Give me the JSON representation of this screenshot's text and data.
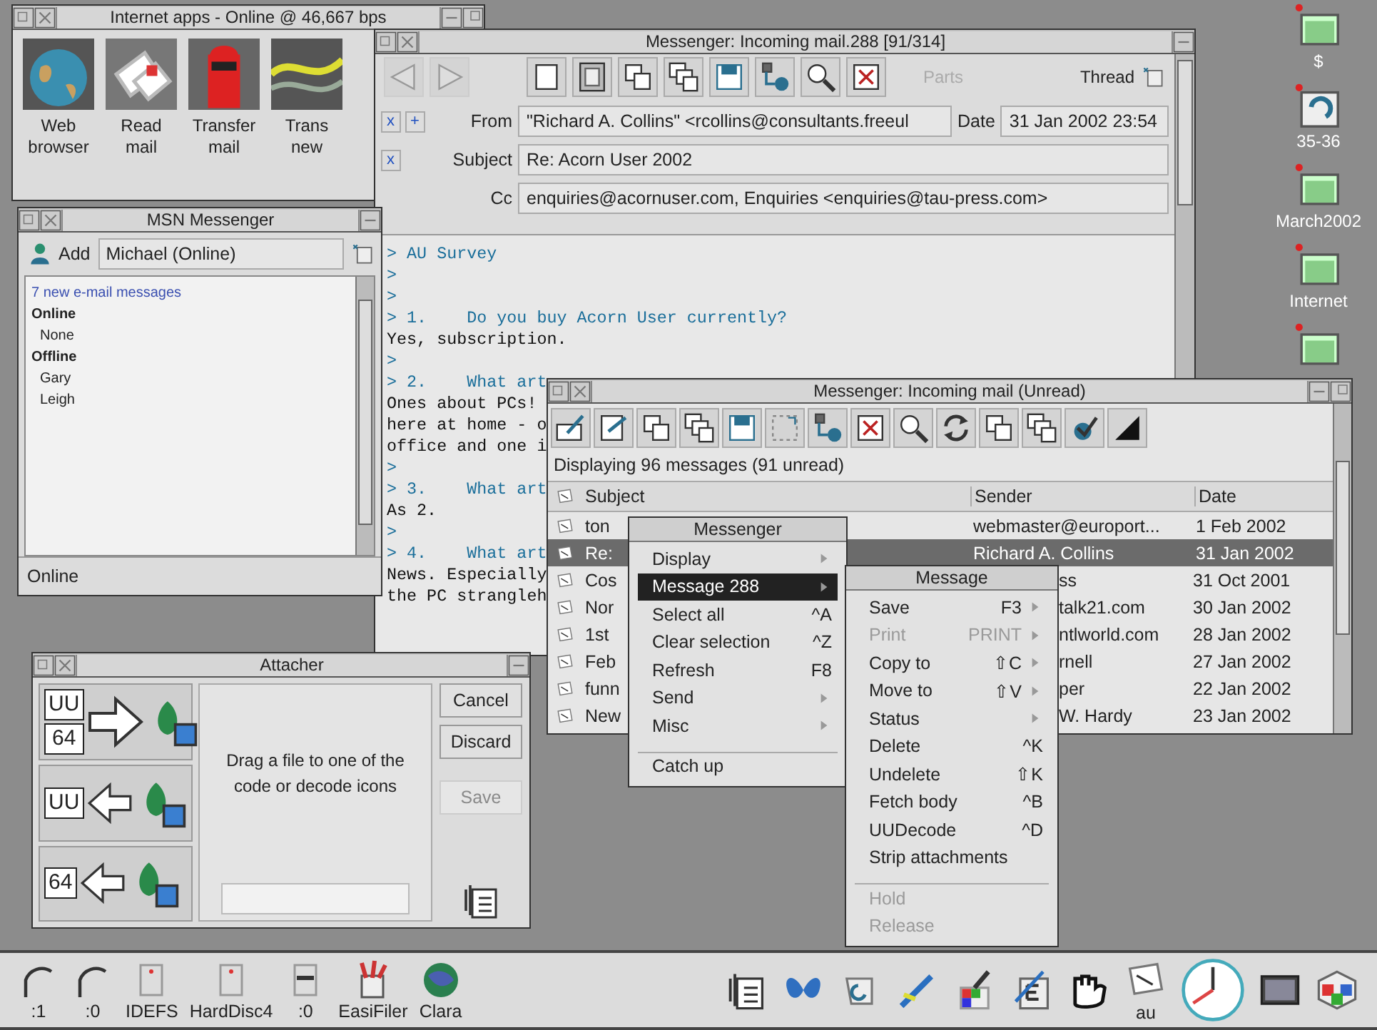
{
  "internet_apps": {
    "title": "Internet apps - Online @ 46,667 bps",
    "apps": [
      {
        "kind": "globe",
        "label_lines": [
          "Web",
          "browser"
        ]
      },
      {
        "kind": "letters",
        "label_lines": [
          "Read",
          "mail"
        ]
      },
      {
        "kind": "postbox",
        "label_lines": [
          "Transfer",
          "mail"
        ]
      },
      {
        "kind": "cable",
        "label_lines": [
          "Trans",
          "new"
        ]
      }
    ]
  },
  "mail_window": {
    "title": "Messenger: Incoming mail.288 [91/314]",
    "parts": {
      "label": "Parts",
      "disabled": true
    },
    "thread_label": "Thread",
    "from": {
      "toggles": [
        "x",
        "+"
      ],
      "label": "From",
      "value": "\"Richard A. Collins\" <rcollins@consultants.freeul",
      "date_label": "Date",
      "date": "31 Jan 2002 23:54"
    },
    "subject": {
      "toggles": [
        "x"
      ],
      "label": "Subject",
      "value": "Re: Acorn User 2002"
    },
    "cc": {
      "label": "Cc",
      "value": "enquiries@acornuser.com, Enquiries <enquiries@tau-press.com>"
    },
    "body_lines": [
      {
        "kind": "quote",
        "text": "> AU Survey"
      },
      {
        "kind": "quote",
        "text": ">"
      },
      {
        "kind": "quote",
        "text": ">"
      },
      {
        "kind": "quote",
        "text": "> 1.    Do you buy Acorn User currently?"
      },
      {
        "kind": "plain",
        "text": "Yes, subscription."
      },
      {
        "kind": "quote",
        "text": ">"
      },
      {
        "kind": "quote",
        "text": "> 2.    What art"
      },
      {
        "kind": "plain",
        "text": "Ones about PCs!"
      },
      {
        "kind": "plain",
        "text": "here at home - o"
      },
      {
        "kind": "plain",
        "text": "office and one i"
      },
      {
        "kind": "quote",
        "text": ">"
      },
      {
        "kind": "quote",
        "text": "> 3.    What art"
      },
      {
        "kind": "plain",
        "text": "As 2."
      },
      {
        "kind": "quote",
        "text": ">"
      },
      {
        "kind": "quote",
        "text": "> 4.    What art"
      },
      {
        "kind": "plain",
        "text": "News. Especially"
      },
      {
        "kind": "plain",
        "text": "the PC strangleh"
      }
    ]
  },
  "msn": {
    "title": "MSN Messenger",
    "add_label": "Add",
    "user": "Michael (Online)",
    "entries": [
      {
        "kind": "link",
        "text": "7 new e-mail messages"
      },
      {
        "kind": "heading",
        "text": "Online"
      },
      {
        "kind": "contact",
        "text": "None"
      },
      {
        "kind": "heading",
        "text": "Offline"
      },
      {
        "kind": "contact",
        "text": "Gary"
      },
      {
        "kind": "contact",
        "text": "Leigh"
      }
    ],
    "status": "Online"
  },
  "list_window": {
    "title": "Messenger: Incoming mail (Unread)",
    "status": "Displaying 96 messages (91 unread)",
    "columns": [
      "Subject",
      "Sender",
      "Date"
    ],
    "rows": [
      {
        "subject": "ton",
        "sender": "webmaster@europort...",
        "date": "1 Feb 2002",
        "selected": false,
        "sender_covered": false
      },
      {
        "subject": "Re:",
        "sender": "Richard A. Collins",
        "date": "31 Jan 2002",
        "selected": true,
        "sender_covered": false
      },
      {
        "subject": "Cos",
        "sender": "ss",
        "date": "31 Oct 2001",
        "selected": false,
        "sender_covered": true
      },
      {
        "subject": "Nor",
        "sender": "talk21.com",
        "date": "30 Jan 2002",
        "selected": false,
        "sender_covered": true
      },
      {
        "subject": "1st",
        "sender": "ntlworld.com",
        "date": "28 Jan 2002",
        "selected": false,
        "sender_covered": true
      },
      {
        "subject": "Feb",
        "sender": "rnell",
        "date": "27 Jan 2002",
        "selected": false,
        "sender_covered": true
      },
      {
        "subject": "funn",
        "sender": "per",
        "date": "22 Jan 2002",
        "selected": false,
        "sender_covered": true
      },
      {
        "subject": "New",
        "sender": "W. Hardy",
        "date": "23 Jan 2002",
        "selected": false,
        "sender_covered": true
      }
    ]
  },
  "context_menu": {
    "title": "Messenger",
    "items": [
      {
        "label": "Display",
        "submenu": true,
        "selected": false
      },
      {
        "label": "Message 288",
        "submenu": true,
        "selected": true
      },
      {
        "label": "Select all",
        "shortcut": "^A",
        "selected": false
      },
      {
        "label": "Clear selection",
        "shortcut": "^Z",
        "selected": false
      },
      {
        "label": "Refresh",
        "shortcut": "F8",
        "selected": false
      },
      {
        "label": "Send",
        "submenu": true,
        "selected": false
      },
      {
        "label": "Misc",
        "submenu": true,
        "selected": false
      },
      {
        "label": "Catch up",
        "separator_before": true,
        "selected": false
      }
    ]
  },
  "submenu": {
    "title": "Message",
    "items": [
      {
        "label": "Save",
        "shortcut": "F3",
        "submenu": true,
        "disabled": false
      },
      {
        "label": "Print",
        "shortcut": "PRINT",
        "submenu": true,
        "disabled": true
      },
      {
        "label": "Copy to",
        "shortcut": "⇧C",
        "submenu": true,
        "disabled": false
      },
      {
        "label": "Move to",
        "shortcut": "⇧V",
        "submenu": true,
        "disabled": false
      },
      {
        "label": "Status",
        "submenu": true,
        "disabled": false
      },
      {
        "label": "Delete",
        "shortcut": "^K",
        "disabled": false
      },
      {
        "label": "Undelete",
        "shortcut": "⇧K",
        "disabled": false
      },
      {
        "label": "Fetch body",
        "shortcut": "^B",
        "disabled": false
      },
      {
        "label": "UUDecode",
        "shortcut": "^D",
        "disabled": false
      },
      {
        "label": "Strip attachments",
        "disabled": false
      },
      {
        "label": "Hold",
        "separator_before": true,
        "disabled": true
      },
      {
        "label": "Release",
        "disabled": true
      }
    ]
  },
  "attacher": {
    "title": "Attacher",
    "rows": [
      {
        "codes": [
          "UU",
          "64"
        ],
        "kind": "encode"
      },
      {
        "codes": [
          "UU"
        ],
        "kind": "decode"
      },
      {
        "codes": [
          "64"
        ],
        "kind": "decode"
      }
    ],
    "hint": "Drag a file to one of the code or decode icons",
    "buttons": [
      {
        "label": "Cancel",
        "disabled": false
      },
      {
        "label": "Discard",
        "disabled": false
      },
      {
        "label": "Save",
        "disabled": true
      }
    ]
  },
  "desktop_icons": [
    {
      "kind": "folder",
      "label": "$"
    },
    {
      "kind": "appfile",
      "label": "35-36"
    },
    {
      "kind": "folder",
      "label": "March2002"
    },
    {
      "kind": "folder",
      "label": "Internet"
    },
    {
      "kind": "folder"
    }
  ],
  "icon_bar": {
    "left": [
      {
        "kind": "floppy",
        "label": ":1"
      },
      {
        "kind": "floppy",
        "label": ":0"
      },
      {
        "kind": "disc",
        "label": "IDEFS"
      },
      {
        "kind": "disc",
        "label": "HardDisc4"
      },
      {
        "kind": "ram",
        "label": ":0"
      },
      {
        "kind": "brushes",
        "label": "EasiFiler"
      },
      {
        "kind": "clara",
        "label": "Clara"
      }
    ],
    "right": [
      {
        "kind": "notepad"
      },
      {
        "kind": "butterfly"
      },
      {
        "kind": "scroll"
      },
      {
        "kind": "penc"
      },
      {
        "kind": "paint"
      },
      {
        "kind": "editE"
      },
      {
        "kind": "fist"
      },
      {
        "kind": "letter",
        "label": "au"
      },
      {
        "kind": "clock"
      },
      {
        "kind": "monitor"
      },
      {
        "kind": "cube"
      }
    ]
  }
}
